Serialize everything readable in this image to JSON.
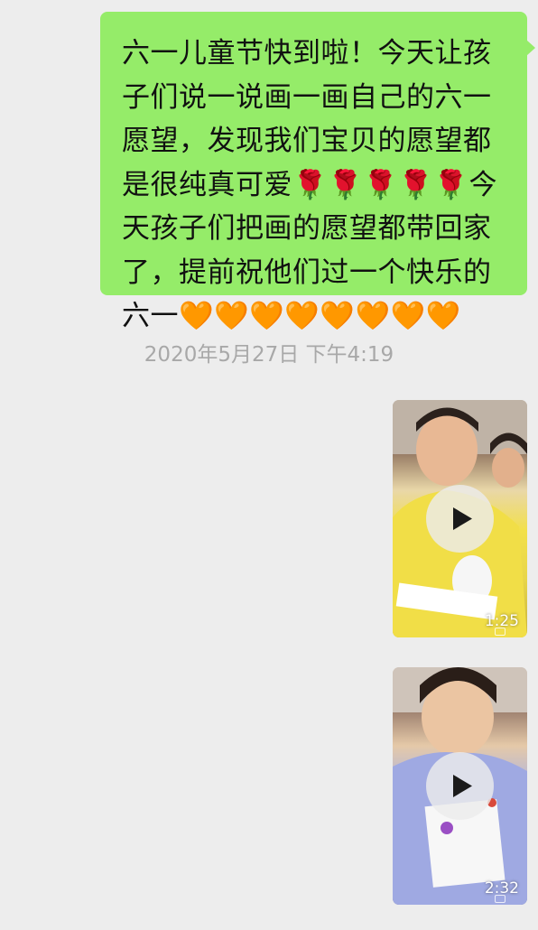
{
  "message": {
    "segments": [
      "六一儿童节快到啦！今天让孩子们说一说画一画自己的六一愿望，发现我们宝贝的愿望都是很纯真可爱",
      "🌹🌹🌹🌹🌹",
      "今天孩子们把画的愿望都带回家了，提前祝他们过一个快乐的六一",
      "🧡🧡🧡🧡🧡🧡🧡🧡"
    ],
    "bubble_color": "#95EC69"
  },
  "timestamp": "2020年5月27日 下午4:19",
  "videos": [
    {
      "duration": "1:25",
      "icon": "play-icon"
    },
    {
      "duration": "2:32",
      "icon": "play-icon"
    }
  ],
  "colors": {
    "background": "#EDEDED",
    "timestamp_text": "#A8A8A8"
  }
}
